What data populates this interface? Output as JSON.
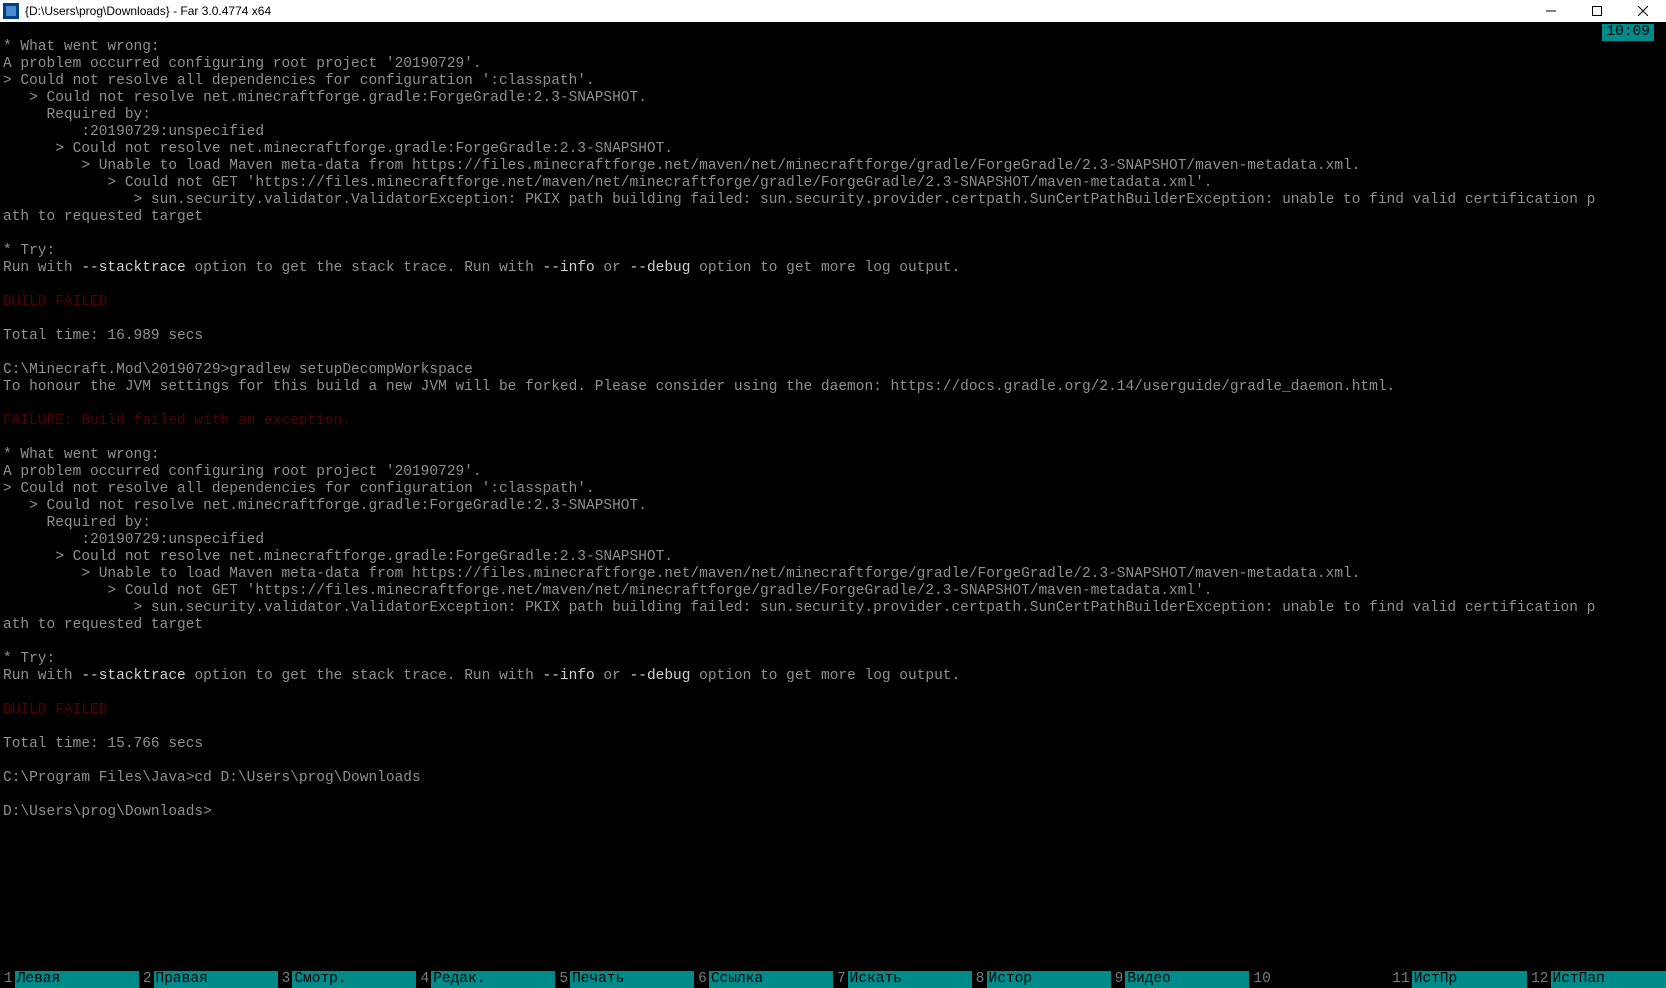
{
  "title": "{D:\\Users\\prog\\Downloads} - Far 3.0.4774 x64",
  "clock": "10:09",
  "console": [
    {
      "t": ""
    },
    {
      "t": "* What went wrong:"
    },
    {
      "t": "A problem occurred configuring root project '20190729'."
    },
    {
      "t": "> Could not resolve all dependencies for configuration ':classpath'."
    },
    {
      "t": "   > Could not resolve net.minecraftforge.gradle:ForgeGradle:2.3-SNAPSHOT."
    },
    {
      "t": "     Required by:"
    },
    {
      "t": "         :20190729:unspecified"
    },
    {
      "t": "      > Could not resolve net.minecraftforge.gradle:ForgeGradle:2.3-SNAPSHOT."
    },
    {
      "t": "         > Unable to load Maven meta-data from https://files.minecraftforge.net/maven/net/minecraftforge/gradle/ForgeGradle/2.3-SNAPSHOT/maven-metadata.xml."
    },
    {
      "t": "            > Could not GET 'https://files.minecraftforge.net/maven/net/minecraftforge/gradle/ForgeGradle/2.3-SNAPSHOT/maven-metadata.xml'."
    },
    {
      "t": "               > sun.security.validator.ValidatorException: PKIX path building failed: sun.security.provider.certpath.SunCertPathBuilderException: unable to find valid certification p"
    },
    {
      "t": "ath to requested target"
    },
    {
      "t": ""
    },
    {
      "t": "* Try:"
    },
    {
      "t": "",
      "segs": [
        {
          "t": "Run with "
        },
        {
          "t": "--stacktrace",
          "c": "bright"
        },
        {
          "t": " option to get the stack trace. Run with "
        },
        {
          "t": "--info",
          "c": "bright"
        },
        {
          "t": " or "
        },
        {
          "t": "--debug",
          "c": "bright"
        },
        {
          "t": " option to get more log output."
        }
      ]
    },
    {
      "t": ""
    },
    {
      "t": "BUILD FAILED",
      "c": "red"
    },
    {
      "t": ""
    },
    {
      "t": "Total time: 16.989 secs"
    },
    {
      "t": ""
    },
    {
      "t": "C:\\Minecraft.Mod\\20190729>gradlew setupDecompWorkspace"
    },
    {
      "t": "To honour the JVM settings for this build a new JVM will be forked. Please consider using the daemon: https://docs.gradle.org/2.14/userguide/gradle_daemon.html."
    },
    {
      "t": ""
    },
    {
      "t": "FAILURE: Build failed with an exception.",
      "c": "red"
    },
    {
      "t": ""
    },
    {
      "t": "* What went wrong:"
    },
    {
      "t": "A problem occurred configuring root project '20190729'."
    },
    {
      "t": "> Could not resolve all dependencies for configuration ':classpath'."
    },
    {
      "t": "   > Could not resolve net.minecraftforge.gradle:ForgeGradle:2.3-SNAPSHOT."
    },
    {
      "t": "     Required by:"
    },
    {
      "t": "         :20190729:unspecified"
    },
    {
      "t": "      > Could not resolve net.minecraftforge.gradle:ForgeGradle:2.3-SNAPSHOT."
    },
    {
      "t": "         > Unable to load Maven meta-data from https://files.minecraftforge.net/maven/net/minecraftforge/gradle/ForgeGradle/2.3-SNAPSHOT/maven-metadata.xml."
    },
    {
      "t": "            > Could not GET 'https://files.minecraftforge.net/maven/net/minecraftforge/gradle/ForgeGradle/2.3-SNAPSHOT/maven-metadata.xml'."
    },
    {
      "t": "               > sun.security.validator.ValidatorException: PKIX path building failed: sun.security.provider.certpath.SunCertPathBuilderException: unable to find valid certification p"
    },
    {
      "t": "ath to requested target"
    },
    {
      "t": ""
    },
    {
      "t": "* Try:"
    },
    {
      "t": "",
      "segs": [
        {
          "t": "Run with "
        },
        {
          "t": "--stacktrace",
          "c": "bright"
        },
        {
          "t": " option to get the stack trace. Run with "
        },
        {
          "t": "--info",
          "c": "bright"
        },
        {
          "t": " or "
        },
        {
          "t": "--debug",
          "c": "bright"
        },
        {
          "t": " option to get more log output."
        }
      ]
    },
    {
      "t": ""
    },
    {
      "t": "BUILD FAILED",
      "c": "red"
    },
    {
      "t": ""
    },
    {
      "t": "Total time: 15.766 secs"
    },
    {
      "t": ""
    },
    {
      "t": "C:\\Program Files\\Java>cd D:\\Users\\prog\\Downloads"
    },
    {
      "t": ""
    },
    {
      "t": "D:\\Users\\prog\\Downloads>"
    }
  ],
  "fkeys": [
    {
      "n": "1",
      "l": "Левая "
    },
    {
      "n": "2",
      "l": "Правая"
    },
    {
      "n": "3",
      "l": "Смотр."
    },
    {
      "n": "4",
      "l": "Редак."
    },
    {
      "n": "5",
      "l": "Печать"
    },
    {
      "n": "6",
      "l": "Ссылка"
    },
    {
      "n": "7",
      "l": "Искать"
    },
    {
      "n": "8",
      "l": "Истор "
    },
    {
      "n": "9",
      "l": "Видео "
    },
    {
      "n": "10",
      "l": "      "
    },
    {
      "n": "11",
      "l": "ИстПр "
    },
    {
      "n": "12",
      "l": "ИстПап"
    }
  ]
}
